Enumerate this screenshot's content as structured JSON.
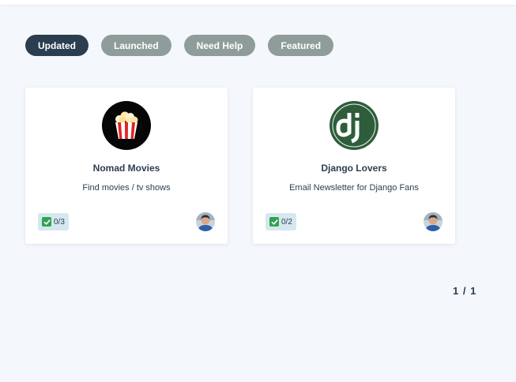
{
  "filters": [
    {
      "label": "Updated",
      "active": true
    },
    {
      "label": "Launched",
      "active": false
    },
    {
      "label": "Need Help",
      "active": false
    },
    {
      "label": "Featured",
      "active": false
    }
  ],
  "projects": [
    {
      "title": "Nomad Movies",
      "description": "Find movies / tv shows",
      "tasks": "0/3",
      "icon": "popcorn-icon"
    },
    {
      "title": "Django Lovers",
      "description": "Email Newsletter for Django Fans",
      "tasks": "0/2",
      "icon": "django-logo"
    }
  ],
  "pagination": {
    "text": "1 / 1"
  },
  "colors": {
    "active_chip": "#2b3e50",
    "inactive_chip": "#8f9d9a",
    "task_badge": "#d5e7ef",
    "check": "#2ea44f"
  }
}
